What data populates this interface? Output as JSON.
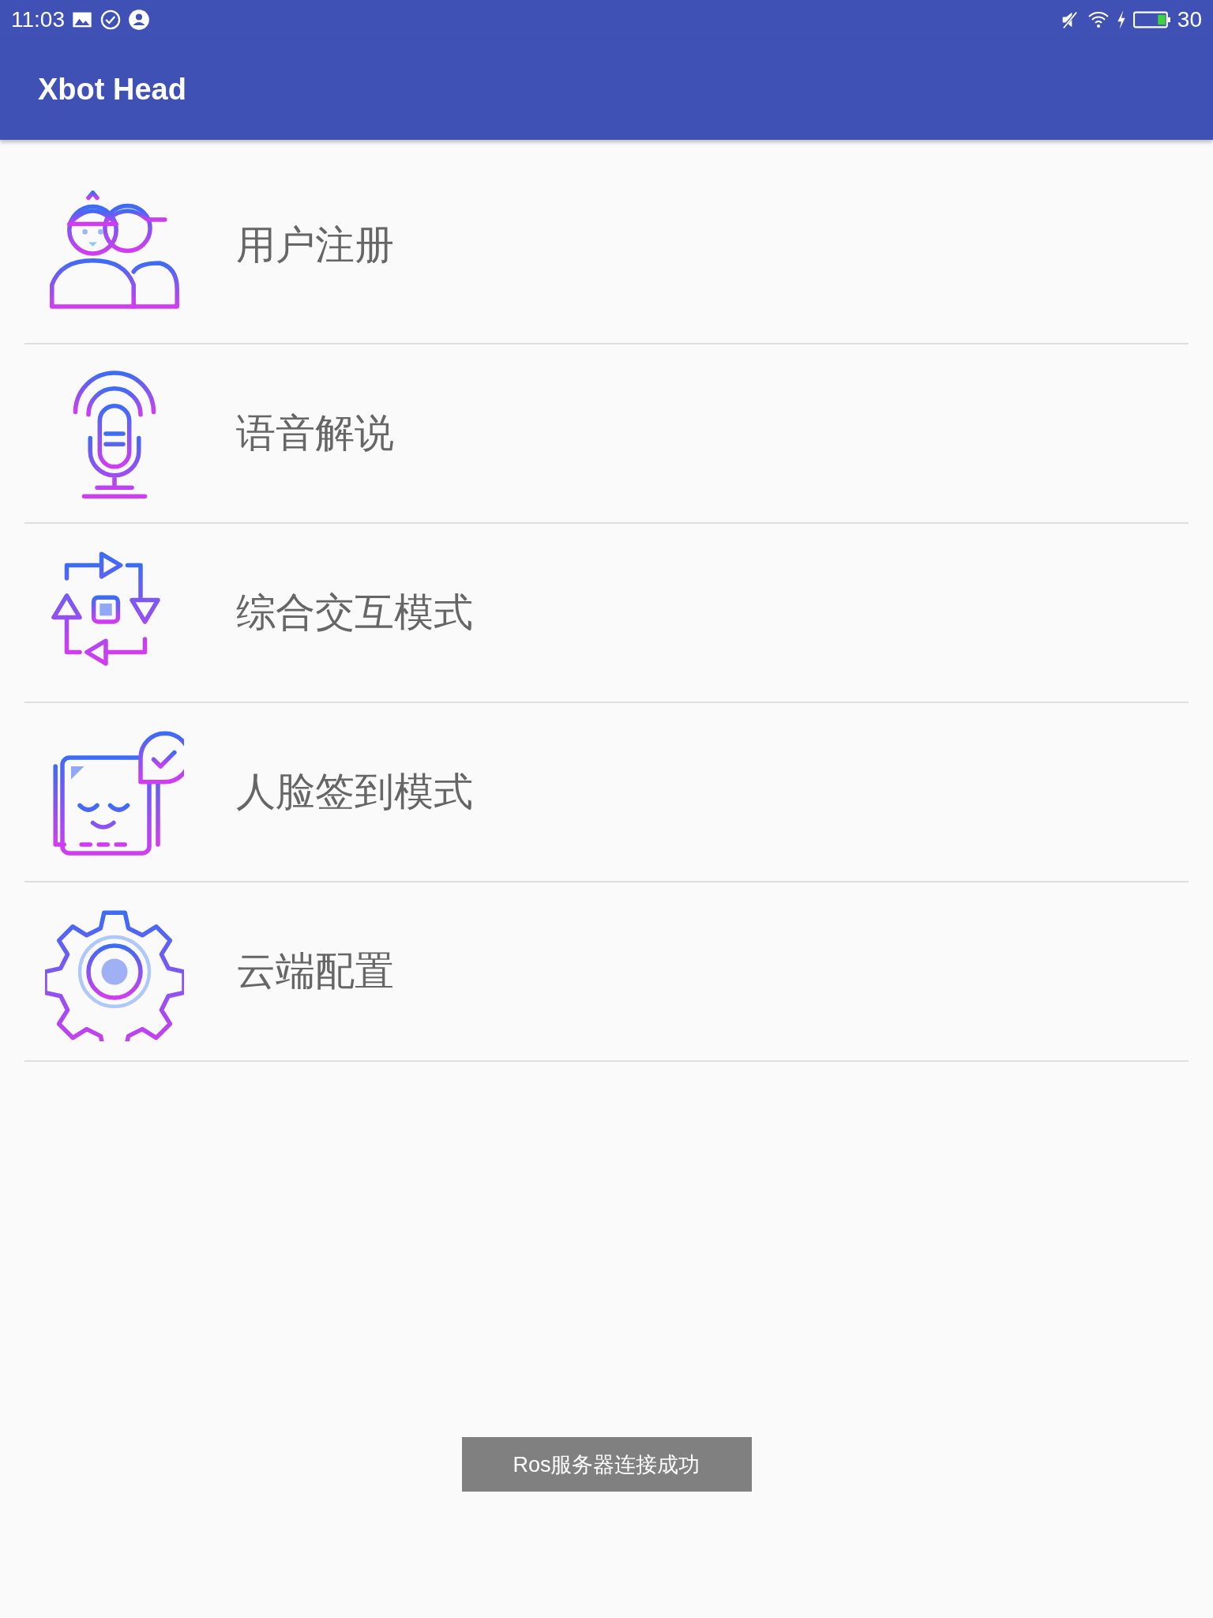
{
  "status_bar": {
    "time": "11:03",
    "battery": "30"
  },
  "app_bar": {
    "title": "Xbot Head"
  },
  "menu": [
    {
      "label": "用户注册"
    },
    {
      "label": "语音解说"
    },
    {
      "label": "综合交互模式"
    },
    {
      "label": "人脸签到模式"
    },
    {
      "label": "云端配置"
    }
  ],
  "toast": {
    "text": "Ros服务器连接成功"
  }
}
